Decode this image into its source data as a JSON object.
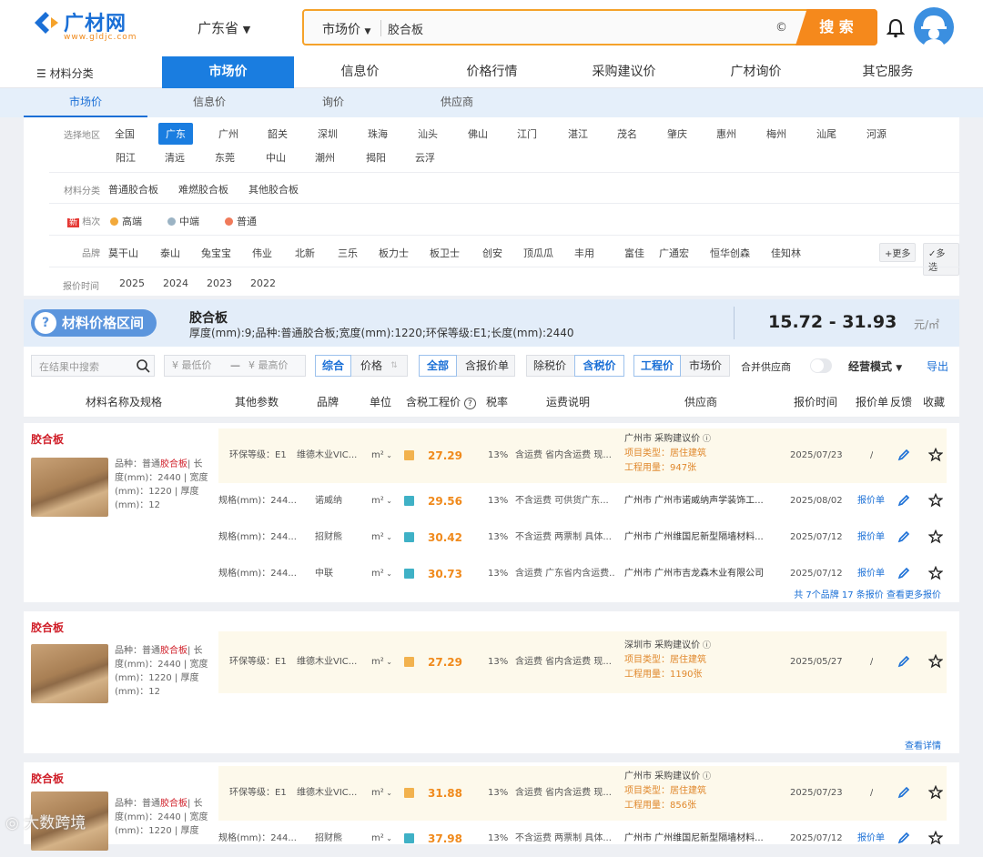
{
  "header": {
    "logo_text": "广材网",
    "logo_url": "www.gldjc.com",
    "province": "广东省",
    "search_type": "市场价",
    "search_value": "胶合板",
    "search_button": "搜 索"
  },
  "mainnav": {
    "category": "材料分类",
    "items": [
      "市场价",
      "信息价",
      "价格行情",
      "采购建议价",
      "广材询价",
      "其它服务"
    ]
  },
  "subtabs": [
    "市场价",
    "信息价",
    "询价",
    "供应商"
  ],
  "filters": {
    "region_label": "选择地区",
    "regions_row1": [
      "全国",
      "广东",
      "广州",
      "韶关",
      "深圳",
      "珠海",
      "汕头",
      "佛山",
      "江门",
      "湛江",
      "茂名",
      "肇庆",
      "惠州",
      "梅州",
      "汕尾",
      "河源"
    ],
    "regions_row2": [
      "阳江",
      "清远",
      "东莞",
      "中山",
      "潮州",
      "揭阳",
      "云浮"
    ],
    "category_label": "材料分类",
    "categories": [
      "普通胶合板",
      "难燃胶合板",
      "其他胶合板"
    ],
    "grade_new": "新",
    "grade_label": "档次",
    "grades": [
      "高端",
      "中端",
      "普通"
    ],
    "brand_label": "品牌",
    "brands": [
      "莫干山",
      "泰山",
      "兔宝宝",
      "伟业",
      "北新",
      "三乐",
      "板力士",
      "板卫士",
      "创安",
      "顶瓜瓜",
      "丰用",
      "富佳",
      "广通宏",
      "恒华创森",
      "佳知林"
    ],
    "more": "+更多",
    "multi": "✓多选",
    "time_label": "报价时间",
    "years": [
      "2025",
      "2024",
      "2023",
      "2022"
    ]
  },
  "pricebar": {
    "pill": "材料价格区间",
    "title": "胶合板",
    "spec": "厚度(mm):9;品种:普通胶合板;宽度(mm):1220;环保等级:E1;长度(mm):2440",
    "range": "15.72 - 31.93",
    "unit": "元/㎡"
  },
  "toolbar": {
    "search_placeholder": "在结果中搜索",
    "min_price": "¥ 最低价",
    "dash": "—",
    "max_price": "¥ 最高价",
    "sort_comprehensive": "综合",
    "sort_price": "价格",
    "scope_all": "全部",
    "scope_tax": "含报价单",
    "tax_ex": "除税价",
    "tax_in": "含税价",
    "price_eng": "工程价",
    "price_market": "市场价",
    "merge": "合并供应商",
    "mode": "经营模式",
    "export": "导出"
  },
  "columns": [
    "材料名称及规格",
    "其他参数",
    "品牌",
    "单位",
    "含税工程价",
    "税率",
    "运费说明",
    "供应商",
    "报价时间",
    "报价单",
    "反馈",
    "收藏"
  ],
  "cards": [
    {
      "title": "胶合板",
      "desc_pre": "品种：普通",
      "desc_hl": "胶合板",
      "desc_post": "| 长度(mm)：2440 | 宽度(mm)：1220 | 厚度(mm)：12",
      "rows": [
        {
          "param": "环保等级：E1",
          "brand": "维德木业VIC...",
          "unit": "m²",
          "price": "27.29",
          "tax": "13%",
          "freight": "含运费 省内含运费 现...",
          "sup_line1": "广州市 采购建议价",
          "sup_line2": "项目类型：居住建筑",
          "sup_line3": "工程用量：947张",
          "date": "2025/07/23",
          "quote": "/"
        },
        {
          "param": "规格(mm)：244...",
          "brand": "诺威纳",
          "unit": "m²",
          "price": "29.56",
          "tax": "13%",
          "freight": "不含运费 可供货广东...",
          "supplier": "广州市 广州市诺威纳声学装饰工...",
          "date": "2025/08/02",
          "quote": "报价单"
        },
        {
          "param": "规格(mm)：244...",
          "brand": "招财熊",
          "unit": "m²",
          "price": "30.42",
          "tax": "13%",
          "freight": "不含运费 两票制 具体...",
          "supplier": "广州市 广州维国尼新型隔墙材料...",
          "date": "2025/07/12",
          "quote": "报价单"
        },
        {
          "param": "规格(mm)：244...",
          "brand": "中联",
          "unit": "m²",
          "price": "30.73",
          "tax": "13%",
          "freight": "含运费 广东省内含运费...",
          "supplier": "广州市 广州市吉龙森木业有限公司",
          "date": "2025/07/12",
          "quote": "报价单"
        }
      ],
      "footer": "共 7个品牌 17 条报价 查看更多报价"
    },
    {
      "title": "胶合板",
      "desc_pre": "品种：普通",
      "desc_hl": "胶合板",
      "desc_post": "| 长度(mm)：2440 | 宽度(mm)：1220 | 厚度(mm)：12",
      "rows": [
        {
          "param": "环保等级：E1",
          "brand": "维德木业VIC...",
          "unit": "m²",
          "price": "27.29",
          "tax": "13%",
          "freight": "含运费 省内含运费 现...",
          "sup_line1": "深圳市 采购建议价",
          "sup_line2": "项目类型：居住建筑",
          "sup_line3": "工程用量：1190张",
          "date": "2025/05/27",
          "quote": "/"
        }
      ],
      "footer": "查看详情"
    },
    {
      "title": "胶合板",
      "desc_pre": "品种：普通",
      "desc_hl": "胶合板",
      "desc_post": "| 长度(mm)：2440 | 宽度(mm)：1220 | 厚度",
      "rows": [
        {
          "param": "环保等级：E1",
          "brand": "维德木业VIC...",
          "unit": "m²",
          "price": "31.88",
          "tax": "13%",
          "freight": "含运费 省内含运费 现...",
          "sup_line1": "广州市 采购建议价",
          "sup_line2": "项目类型：居住建筑",
          "sup_line3": "工程用量：856张",
          "date": "2025/07/23",
          "quote": "/"
        },
        {
          "param": "规格(mm)：244...",
          "brand": "招财熊",
          "unit": "m²",
          "price": "37.98",
          "tax": "13%",
          "freight": "不含运费 两票制 具体...",
          "supplier": "广州市 广州维国尼新型隔墙材料...",
          "date": "2025/07/12",
          "quote": "报价单"
        }
      ]
    }
  ],
  "watermark": "大数跨境"
}
